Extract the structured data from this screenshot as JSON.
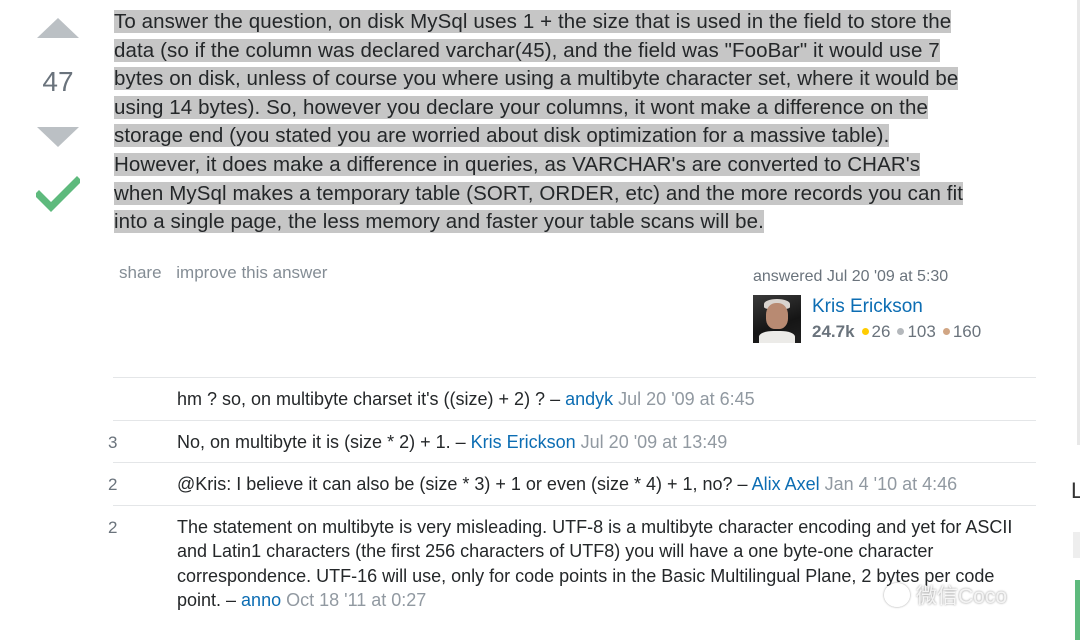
{
  "vote": {
    "count": "47"
  },
  "answer": {
    "lines": [
      "To answer the question, on disk MySql uses 1 + the size that is used in the field to store the",
      "data (so if the column was declared varchar(45), and the field was \"FooBar\" it would use 7",
      "bytes on disk, unless of course you where using a multibyte character set, where it would be",
      "using 14 bytes). So, however you declare your columns, it wont make a difference on the",
      "storage end (you stated you are worried about disk optimization for a massive table).",
      "However, it does make a difference in queries, as VARCHAR's are converted to CHAR's",
      "when MySql makes a temporary table (SORT, ORDER, etc) and the more records you can fit",
      "into a single page, the less memory and faster your table scans will be."
    ]
  },
  "post_menu": {
    "share": "share",
    "improve": "improve this answer"
  },
  "user_card": {
    "answered": "answered Jul 20 '09 at 5:30",
    "name": "Kris Erickson",
    "reputation": "24.7k",
    "gold": "26",
    "silver": "103",
    "bronze": "160"
  },
  "comments": [
    {
      "score": "",
      "text": "hm ? so, on multibyte charset it's ((size) + 2) ? – ",
      "user": "andyk",
      "date": "Jul 20 '09 at 6:45"
    },
    {
      "score": "3",
      "text": "No, on multibyte it is (size * 2) + 1. – ",
      "user": "Kris Erickson",
      "date": "Jul 20 '09 at 13:49"
    },
    {
      "score": "2",
      "text": "@Kris: I believe it can also be (size * 3) + 1 or even (size * 4) + 1, no? – ",
      "user": "Alix Axel",
      "date": "Jan 4 '10 at 4:46"
    },
    {
      "score": "2",
      "text": "The statement on multibyte is very misleading. UTF-8 is a multibyte character encoding and yet for ASCII and Latin1 characters (the first 256 characters of UTF8) you will have a one byte-one character correspondence. UTF-16 will use, only for code points in the Basic Multilingual Plane, 2 bytes per code point. – ",
      "user": "anno",
      "date": "Oct 18 '11 at 0:27"
    }
  ],
  "edge": {
    "letter": "L"
  },
  "watermark": {
    "text": "微信Coco"
  },
  "colors": {
    "link": "#0c6db3",
    "accepted": "#5eba7d",
    "highlight": "#c6c6c6"
  },
  "icons": {
    "upvote": "arrow-up-icon",
    "downvote": "arrow-down-icon",
    "accepted": "checkmark-icon"
  }
}
